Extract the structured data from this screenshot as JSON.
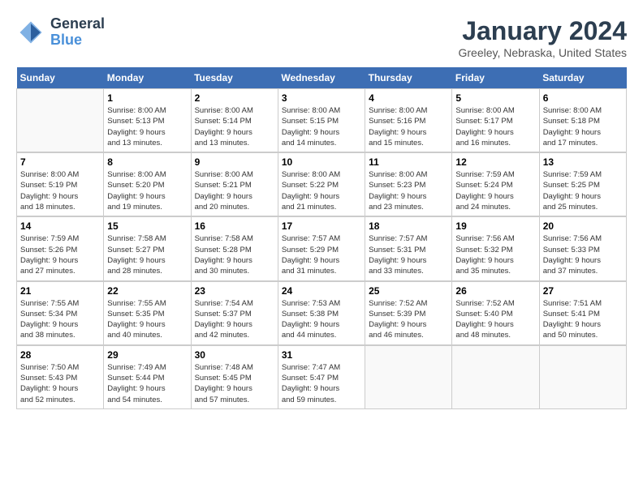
{
  "logo": {
    "text_general": "General",
    "text_blue": "Blue"
  },
  "title": "January 2024",
  "subtitle": "Greeley, Nebraska, United States",
  "headers": [
    "Sunday",
    "Monday",
    "Tuesday",
    "Wednesday",
    "Thursday",
    "Friday",
    "Saturday"
  ],
  "weeks": [
    [
      {
        "day": "",
        "info": ""
      },
      {
        "day": "1",
        "info": "Sunrise: 8:00 AM\nSunset: 5:13 PM\nDaylight: 9 hours\nand 13 minutes."
      },
      {
        "day": "2",
        "info": "Sunrise: 8:00 AM\nSunset: 5:14 PM\nDaylight: 9 hours\nand 13 minutes."
      },
      {
        "day": "3",
        "info": "Sunrise: 8:00 AM\nSunset: 5:15 PM\nDaylight: 9 hours\nand 14 minutes."
      },
      {
        "day": "4",
        "info": "Sunrise: 8:00 AM\nSunset: 5:16 PM\nDaylight: 9 hours\nand 15 minutes."
      },
      {
        "day": "5",
        "info": "Sunrise: 8:00 AM\nSunset: 5:17 PM\nDaylight: 9 hours\nand 16 minutes."
      },
      {
        "day": "6",
        "info": "Sunrise: 8:00 AM\nSunset: 5:18 PM\nDaylight: 9 hours\nand 17 minutes."
      }
    ],
    [
      {
        "day": "7",
        "info": "Sunrise: 8:00 AM\nSunset: 5:19 PM\nDaylight: 9 hours\nand 18 minutes."
      },
      {
        "day": "8",
        "info": "Sunrise: 8:00 AM\nSunset: 5:20 PM\nDaylight: 9 hours\nand 19 minutes."
      },
      {
        "day": "9",
        "info": "Sunrise: 8:00 AM\nSunset: 5:21 PM\nDaylight: 9 hours\nand 20 minutes."
      },
      {
        "day": "10",
        "info": "Sunrise: 8:00 AM\nSunset: 5:22 PM\nDaylight: 9 hours\nand 21 minutes."
      },
      {
        "day": "11",
        "info": "Sunrise: 8:00 AM\nSunset: 5:23 PM\nDaylight: 9 hours\nand 23 minutes."
      },
      {
        "day": "12",
        "info": "Sunrise: 7:59 AM\nSunset: 5:24 PM\nDaylight: 9 hours\nand 24 minutes."
      },
      {
        "day": "13",
        "info": "Sunrise: 7:59 AM\nSunset: 5:25 PM\nDaylight: 9 hours\nand 25 minutes."
      }
    ],
    [
      {
        "day": "14",
        "info": "Sunrise: 7:59 AM\nSunset: 5:26 PM\nDaylight: 9 hours\nand 27 minutes."
      },
      {
        "day": "15",
        "info": "Sunrise: 7:58 AM\nSunset: 5:27 PM\nDaylight: 9 hours\nand 28 minutes."
      },
      {
        "day": "16",
        "info": "Sunrise: 7:58 AM\nSunset: 5:28 PM\nDaylight: 9 hours\nand 30 minutes."
      },
      {
        "day": "17",
        "info": "Sunrise: 7:57 AM\nSunset: 5:29 PM\nDaylight: 9 hours\nand 31 minutes."
      },
      {
        "day": "18",
        "info": "Sunrise: 7:57 AM\nSunset: 5:31 PM\nDaylight: 9 hours\nand 33 minutes."
      },
      {
        "day": "19",
        "info": "Sunrise: 7:56 AM\nSunset: 5:32 PM\nDaylight: 9 hours\nand 35 minutes."
      },
      {
        "day": "20",
        "info": "Sunrise: 7:56 AM\nSunset: 5:33 PM\nDaylight: 9 hours\nand 37 minutes."
      }
    ],
    [
      {
        "day": "21",
        "info": "Sunrise: 7:55 AM\nSunset: 5:34 PM\nDaylight: 9 hours\nand 38 minutes."
      },
      {
        "day": "22",
        "info": "Sunrise: 7:55 AM\nSunset: 5:35 PM\nDaylight: 9 hours\nand 40 minutes."
      },
      {
        "day": "23",
        "info": "Sunrise: 7:54 AM\nSunset: 5:37 PM\nDaylight: 9 hours\nand 42 minutes."
      },
      {
        "day": "24",
        "info": "Sunrise: 7:53 AM\nSunset: 5:38 PM\nDaylight: 9 hours\nand 44 minutes."
      },
      {
        "day": "25",
        "info": "Sunrise: 7:52 AM\nSunset: 5:39 PM\nDaylight: 9 hours\nand 46 minutes."
      },
      {
        "day": "26",
        "info": "Sunrise: 7:52 AM\nSunset: 5:40 PM\nDaylight: 9 hours\nand 48 minutes."
      },
      {
        "day": "27",
        "info": "Sunrise: 7:51 AM\nSunset: 5:41 PM\nDaylight: 9 hours\nand 50 minutes."
      }
    ],
    [
      {
        "day": "28",
        "info": "Sunrise: 7:50 AM\nSunset: 5:43 PM\nDaylight: 9 hours\nand 52 minutes."
      },
      {
        "day": "29",
        "info": "Sunrise: 7:49 AM\nSunset: 5:44 PM\nDaylight: 9 hours\nand 54 minutes."
      },
      {
        "day": "30",
        "info": "Sunrise: 7:48 AM\nSunset: 5:45 PM\nDaylight: 9 hours\nand 57 minutes."
      },
      {
        "day": "31",
        "info": "Sunrise: 7:47 AM\nSunset: 5:47 PM\nDaylight: 9 hours\nand 59 minutes."
      },
      {
        "day": "",
        "info": ""
      },
      {
        "day": "",
        "info": ""
      },
      {
        "day": "",
        "info": ""
      }
    ]
  ]
}
